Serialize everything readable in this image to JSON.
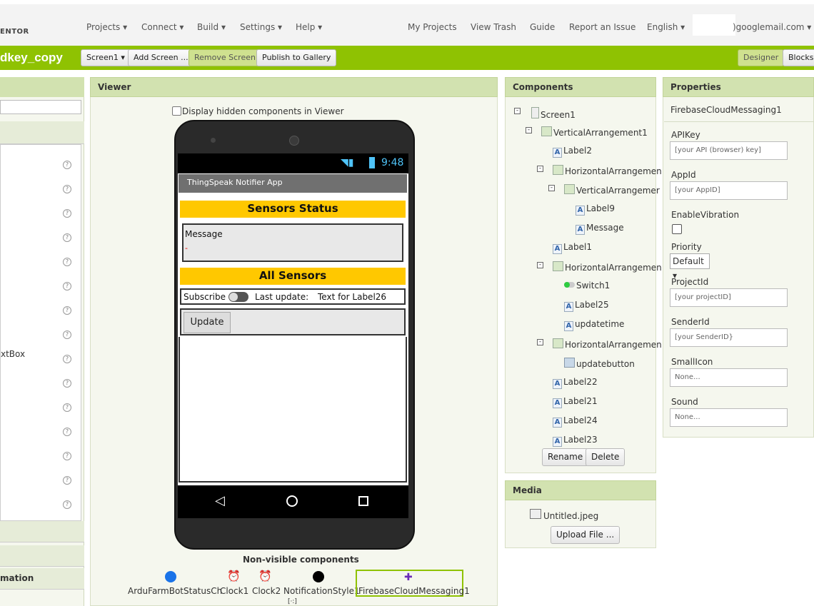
{
  "topnav": {
    "logo": "ENTOR",
    "menus": [
      "Projects ▾",
      "Connect ▾",
      "Build ▾",
      "Settings ▾",
      "Help ▾"
    ],
    "links": [
      "My Projects",
      "View Trash",
      "Guide",
      "Report an Issue",
      "English ▾"
    ],
    "account": ")googlemail.com ▾"
  },
  "toolbar": {
    "project_name": "dkey_copy",
    "screen_select": "Screen1 ▾",
    "add_screen": "Add Screen ...",
    "remove_screen": "Remove Screen",
    "publish": "Publish to Gallery",
    "designer": "Designer",
    "blocks": "Blocks"
  },
  "palette": {
    "partial_item": "xtBox",
    "partial_section": "mation"
  },
  "viewer": {
    "title": "Viewer",
    "hidden_checkbox_label": "Display hidden components in Viewer",
    "phone": {
      "time": "9:48",
      "app_title": "ThingSpeak Notifier App",
      "sensors_status": "Sensors Status",
      "message_label": "Message",
      "message_value": "-",
      "all_sensors": "All Sensors",
      "subscribe": "Subscribe",
      "last_update": "Last update:",
      "label26": "Text for Label26",
      "update_button": "Update"
    },
    "nonvisible_title": "Non-visible components",
    "nonvisible": [
      "ArduFarmBotStatusCh",
      "Clock1",
      "Clock2",
      "NotificationStyle1",
      "FirebaseCloudMessaging1"
    ]
  },
  "components": {
    "title": "Components",
    "items": [
      "Screen1",
      "VerticalArrangement1",
      "Label2",
      "HorizontalArrangemen",
      "VerticalArrangemer",
      "Label9",
      "Message",
      "Label1",
      "HorizontalArrangemen",
      "Switch1",
      "Label25",
      "updatetime",
      "HorizontalArrangemen",
      "updatebutton",
      "Label22",
      "Label21",
      "Label24",
      "Label23"
    ],
    "rename": "Rename",
    "delete": "Delete"
  },
  "media": {
    "title": "Media",
    "file": "Untitled.jpeg",
    "upload": "Upload File ..."
  },
  "properties": {
    "title": "Properties",
    "component": "FirebaseCloudMessaging1",
    "apikey_label": "APIKey",
    "apikey_value": "[your API (browser) key]",
    "appid_label": "AppId",
    "appid_value": "[your AppID]",
    "vibration_label": "EnableVibration",
    "priority_label": "Priority",
    "priority_value": "Default ▾",
    "projectid_label": "ProjectId",
    "projectid_value": "[your projectID]",
    "senderid_label": "SenderId",
    "senderid_value": "[your SenderID}",
    "smallicon_label": "SmallIcon",
    "smallicon_value": "None...",
    "sound_label": "Sound",
    "sound_value": "None..."
  },
  "colors": {
    "toolbar_green": "#8fc202",
    "panel_header": "#d2e2b0",
    "sensor_bar": "#ffc800"
  }
}
